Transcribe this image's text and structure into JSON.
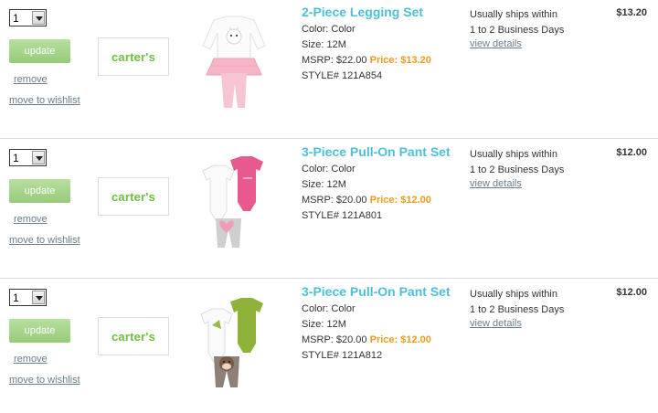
{
  "cart_items": [
    {
      "qty": "1",
      "update_label": "update",
      "remove_label": "remove",
      "wishlist_label": "move to wishlist",
      "brand": "carter's",
      "title": "2-Piece Legging Set",
      "color": "Color: Color",
      "size": "Size: 12M",
      "msrp": "MSRP: $22.00",
      "price": "Price: $13.20",
      "style": "STYLE# 121A854",
      "ship_line1": "Usually ships within",
      "ship_line2": "1 to 2 Business Days",
      "details_label": "view details",
      "total": "$13.20"
    },
    {
      "qty": "1",
      "update_label": "update",
      "remove_label": "remove",
      "wishlist_label": "move to wishlist",
      "brand": "carter's",
      "title": "3-Piece Pull-On Pant Set",
      "color": "Color: Color",
      "size": "Size: 12M",
      "msrp": "MSRP: $20.00",
      "price": "Price: $12.00",
      "style": "STYLE# 121A801",
      "ship_line1": "Usually ships within",
      "ship_line2": "1 to 2 Business Days",
      "details_label": "view details",
      "total": "$12.00"
    },
    {
      "qty": "1",
      "update_label": "update",
      "remove_label": "remove",
      "wishlist_label": "move to wishlist",
      "brand": "carter's",
      "title": "3-Piece Pull-On Pant Set",
      "color": "Color: Color",
      "size": "Size: 12M",
      "msrp": "MSRP: $20.00",
      "price": "Price: $12.00",
      "style": "STYLE# 121A812",
      "ship_line1": "Usually ships within",
      "ship_line2": "1 to 2 Business Days",
      "details_label": "view details",
      "total": "$12.00"
    }
  ],
  "colors": {
    "accent_title": "#4dc0d8",
    "price": "#f29a1e",
    "brand": "#6dbf3c",
    "update_button": "#a8d68c"
  }
}
